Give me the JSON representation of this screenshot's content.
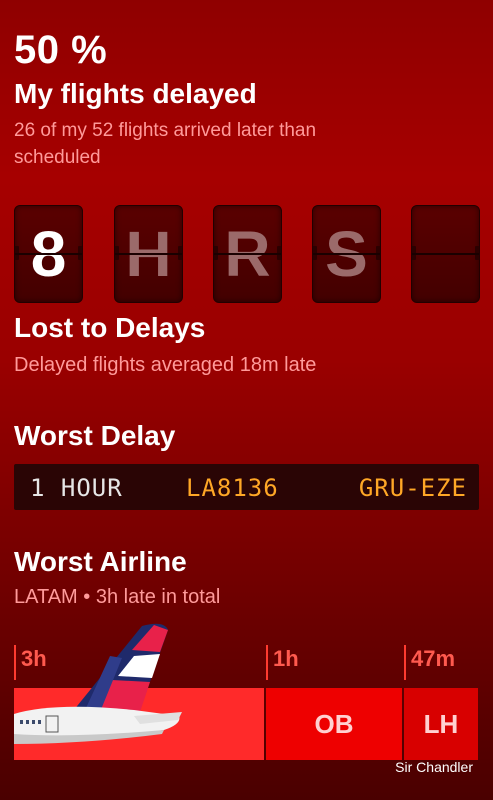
{
  "summary": {
    "percent": "50 %",
    "title": "My flights delayed",
    "subtitle": "26 of my 52 flights arrived later than scheduled"
  },
  "flip_board": {
    "characters": [
      "8",
      "H",
      "R",
      "S",
      ""
    ]
  },
  "lost": {
    "title": "Lost to Delays",
    "subtitle": "Delayed flights averaged 18m late"
  },
  "worst_delay": {
    "title": "Worst Delay",
    "duration": "1 HOUR",
    "flight": "LA8136",
    "route": "GRU-EZE"
  },
  "worst_airline": {
    "title": "Worst Airline",
    "subtitle": "LATAM • 3h late in total",
    "bars": [
      {
        "value_label": "3h",
        "airline": "",
        "hours": 3
      },
      {
        "value_label": "1h",
        "airline": "OB",
        "hours": 1
      },
      {
        "value_label": "47m",
        "airline": "LH",
        "hours": 0.78
      }
    ]
  },
  "credit": "Sir Chandler",
  "colors": {
    "accent": "#ff3b30",
    "subtle_text": "#ff9a9a",
    "board_amber": "#ffa726"
  },
  "icons": [
    "airplane-tail-icon"
  ]
}
